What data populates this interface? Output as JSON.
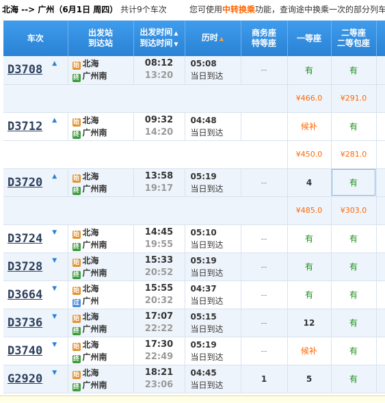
{
  "header": {
    "route": "北海 --> 广州（6月1日  周四）",
    "count": "共计9个车次",
    "hint_prefix": "您可使用",
    "hint_link": "中转换乘",
    "hint_suffix": "功能，查询途中换乘一次的部分列车"
  },
  "columns": {
    "train": "车次",
    "station_top": "出发站",
    "station_bottom": "到达站",
    "time_top": "出发时间",
    "time_bottom": "到达时间",
    "duration": "历时",
    "business_top": "商务座",
    "business_bottom": "特等座",
    "first": "一等座",
    "second_top": "二等座",
    "second_bottom": "二等包座"
  },
  "icons": {
    "start": "始",
    "end": "终",
    "pass": "过"
  },
  "trains": [
    {
      "no": "D3708",
      "arrow": "▲",
      "from": "北海",
      "to": "广州南",
      "to_icon": "终",
      "dep": "08:12",
      "arr": "13:20",
      "dur": "05:08",
      "day": "当日到达",
      "business": "--",
      "first": "有",
      "second": "有",
      "price_first": "¥466.0",
      "price_second": "¥291.0"
    },
    {
      "no": "D3712",
      "arrow": "▲",
      "from": "北海",
      "to": "广州南",
      "to_icon": "终",
      "dep": "09:32",
      "arr": "14:20",
      "dur": "04:48",
      "day": "当日到达",
      "business": "",
      "first": "候补",
      "second": "有",
      "price_first": "¥450.0",
      "price_second": "¥281.0"
    },
    {
      "no": "D3720",
      "arrow": "▲",
      "from": "北海",
      "to": "广州南",
      "to_icon": "终",
      "dep": "13:58",
      "arr": "19:17",
      "dur": "05:19",
      "day": "当日到达",
      "business": "--",
      "first": "4",
      "second": "有",
      "price_first": "¥485.0",
      "price_second": "¥303.0"
    },
    {
      "no": "D3724",
      "arrow": "▼",
      "from": "北海",
      "to": "广州南",
      "to_icon": "终",
      "dep": "14:45",
      "arr": "19:55",
      "dur": "05:10",
      "day": "当日到达",
      "business": "--",
      "first": "有",
      "second": "有"
    },
    {
      "no": "D3728",
      "arrow": "▼",
      "from": "北海",
      "to": "广州南",
      "to_icon": "终",
      "dep": "15:33",
      "arr": "20:52",
      "dur": "05:19",
      "day": "当日到达",
      "business": "--",
      "first": "有",
      "second": "有"
    },
    {
      "no": "D3664",
      "arrow": "▼",
      "from": "北海",
      "to": "广州",
      "to_icon": "过",
      "dep": "15:55",
      "arr": "20:32",
      "dur": "04:37",
      "day": "当日到达",
      "business": "--",
      "first": "有",
      "second": "有"
    },
    {
      "no": "D3736",
      "arrow": "▼",
      "from": "北海",
      "to": "广州南",
      "to_icon": "终",
      "dep": "17:07",
      "arr": "22:22",
      "dur": "05:15",
      "day": "当日到达",
      "business": "--",
      "first": "12",
      "second": "有"
    },
    {
      "no": "D3740",
      "arrow": "▼",
      "from": "北海",
      "to": "广州南",
      "to_icon": "终",
      "dep": "17:30",
      "arr": "22:49",
      "dur": "05:19",
      "day": "当日到达",
      "business": "--",
      "first": "候补",
      "second": "有"
    },
    {
      "no": "G2920",
      "arrow": "▼",
      "from": "北海",
      "to": "广州南",
      "to_icon": "终",
      "dep": "18:21",
      "arr": "23:06",
      "dur": "04:45",
      "day": "当日到达",
      "business": "1",
      "first": "5",
      "second": "有"
    }
  ]
}
